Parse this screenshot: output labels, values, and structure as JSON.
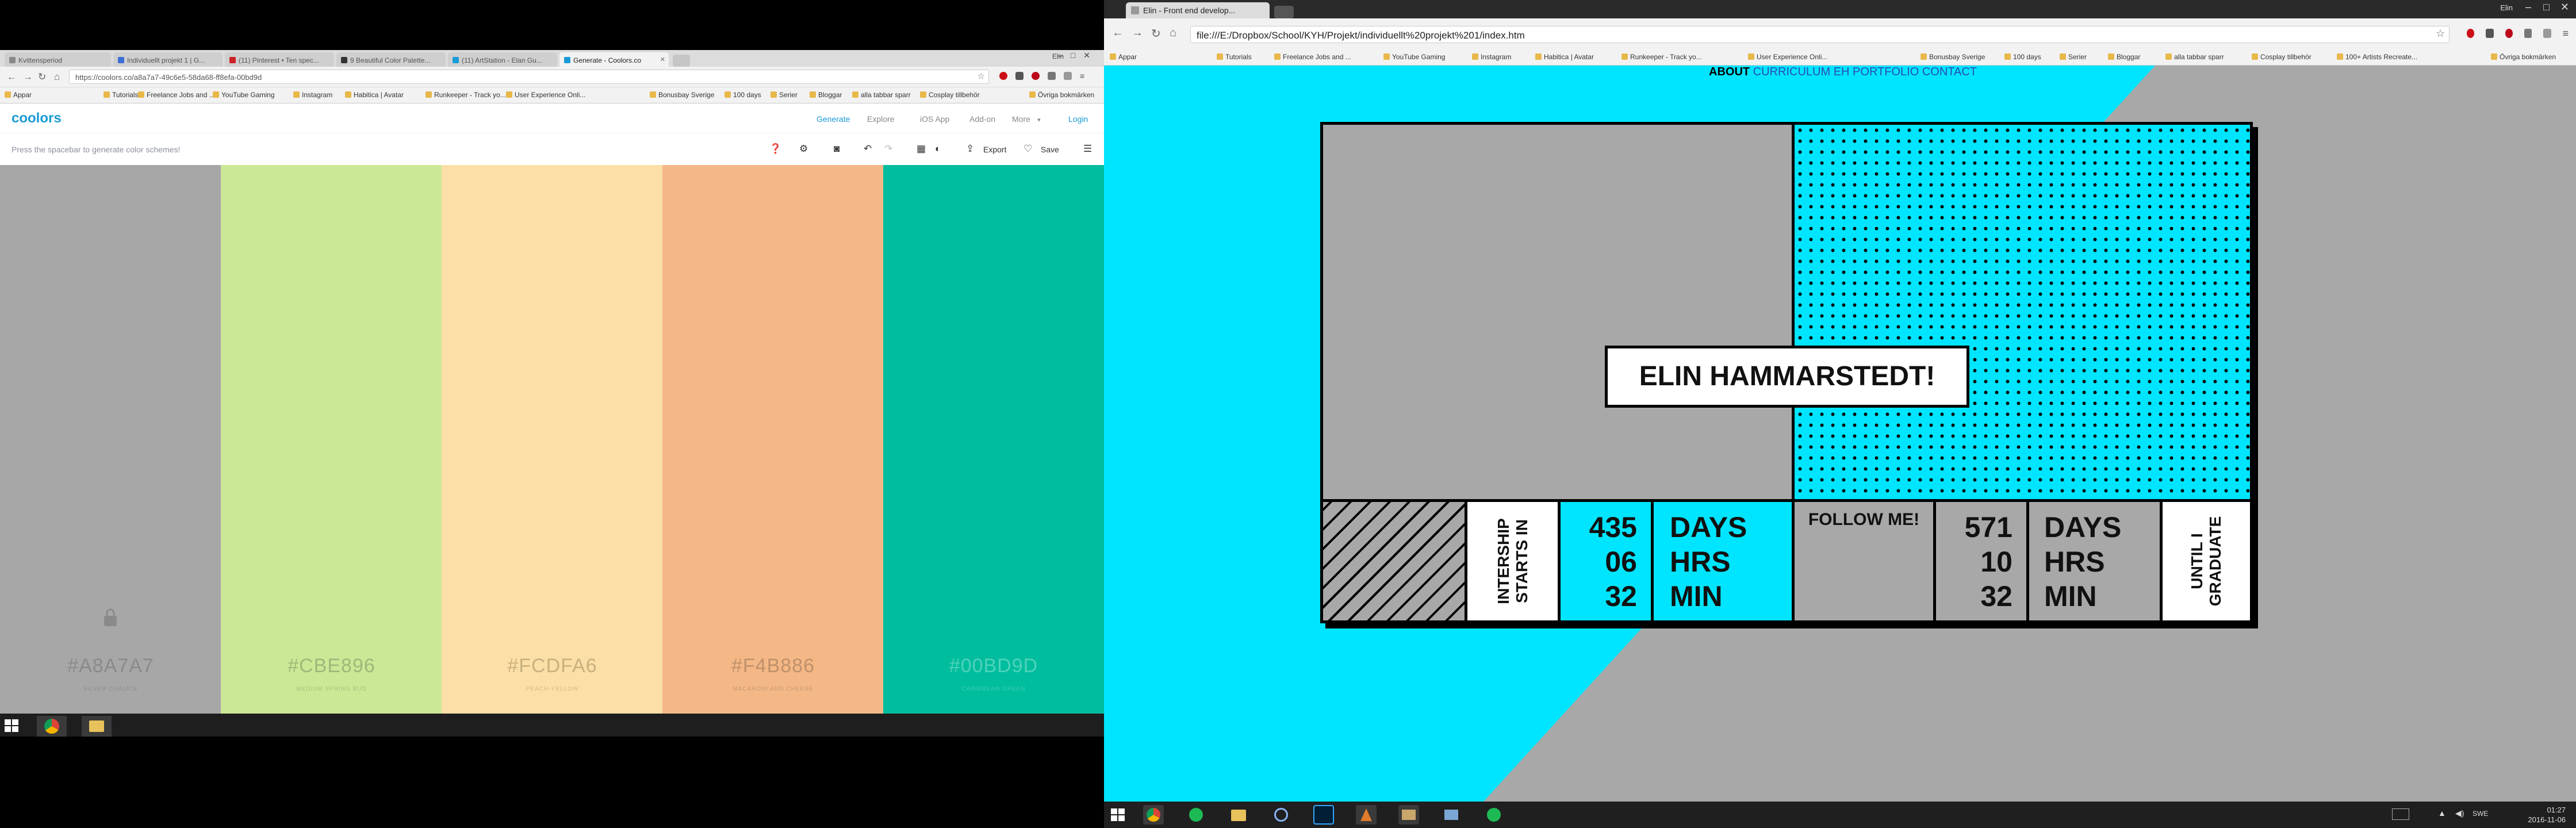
{
  "left_window": {
    "tabs": [
      {
        "label": "Kvittensperiod"
      },
      {
        "label": "Individuellt projekt 1 | G..."
      },
      {
        "label": "(11) Pinterest • Ten spec..."
      },
      {
        "label": "9 Beautiful Color Palette..."
      },
      {
        "label": "(11) ArtStation - Elan Gu..."
      },
      {
        "label": "Generate - Coolors.co"
      }
    ],
    "user": "Elin",
    "url": "https://coolors.co/a8a7a7-49c6e5-58da68-ff8efa-00bd9d",
    "bookmarks": [
      "Appar",
      "Tutorials",
      "Freelance Jobs and ...",
      "YouTube Gaming",
      "Instagram",
      "Habitica | Avatar",
      "Runkeeper - Track yo...",
      "User Experience Onli...",
      "Bonusbay Sverige",
      "100 days",
      "Serier",
      "Bloggar",
      "alla tabbar sparr",
      "Cosplay tillbehör",
      "Övriga bokmärken"
    ],
    "coolors": {
      "logo": "coolors",
      "nav": [
        "Generate",
        "Explore",
        "iOS App",
        "Add-on",
        "More",
        "Login"
      ],
      "hint": "Press the spacebar to generate color schemes!",
      "export_label": "Export",
      "save_label": "Save",
      "swatches": [
        {
          "hex": "#A8A7A7",
          "name": "Silver Chalice",
          "color": "#A8A7A7",
          "text": "#8b8a8a",
          "sub": "#8f8e8e"
        },
        {
          "hex": "#CBE896",
          "name": "Medium Spring Bud",
          "color": "#CBE896",
          "text": "#9fb87a",
          "sub": "#a9c27f"
        },
        {
          "hex": "#FCDFA6",
          "name": "Peach-Yellow",
          "color": "#FCDFA6",
          "text": "#c9b07f",
          "sub": "#d2b985"
        },
        {
          "hex": "#F4B886",
          "name": "Macaroni and Cheese",
          "color": "#F4B886",
          "text": "#c0916a",
          "sub": "#c99870"
        },
        {
          "hex": "#00BD9D",
          "name": "Caribbean Green",
          "color": "#00BD9D",
          "text": "#4ed3bb",
          "sub": "#3cccb2"
        }
      ]
    }
  },
  "right_window": {
    "tab_title": "Elin - Front end develop...",
    "user": "Elin",
    "url": "file:///E:/Dropbox/School/KYH/Projekt/individuellt%20projekt%201/index.htm",
    "bookmarks": [
      "Appar",
      "Tutorials",
      "Freelance Jobs and ...",
      "YouTube Gaming",
      "Instagram",
      "Habitica | Avatar",
      "Runkeeper - Track yo...",
      "User Experience Onli...",
      "Bonusbay Sverige",
      "100 days",
      "Serier",
      "Bloggar",
      "alla tabbar sparr",
      "Cosplay tillbehör",
      "100+ Artists Recreate...",
      "Övriga bokmärken"
    ],
    "site": {
      "nav": [
        "ABOUT",
        "CURRICULUM",
        "EH",
        "PORTFOLIO",
        "CONTACT"
      ],
      "name": "ELIN HAMMARSTEDT!",
      "internship_label": "INTERSHIP STARTS IN",
      "internship": {
        "days": "435",
        "hrs": "06",
        "min": "32"
      },
      "unit_days": "DAYS",
      "unit_hrs": "HRS",
      "unit_min": "MIN",
      "follow": "FOLLOW ME!",
      "graduate": {
        "days": "571",
        "hrs": "10",
        "min": "32"
      },
      "graduate_label": "UNTIL I GRADUATE"
    },
    "clock": {
      "time": "01:27",
      "date": "2016-11-06",
      "lang": "SWE"
    }
  },
  "colors": {
    "cyan": "#00E5FF",
    "gray": "#A8A8A8",
    "black": "#000000"
  }
}
